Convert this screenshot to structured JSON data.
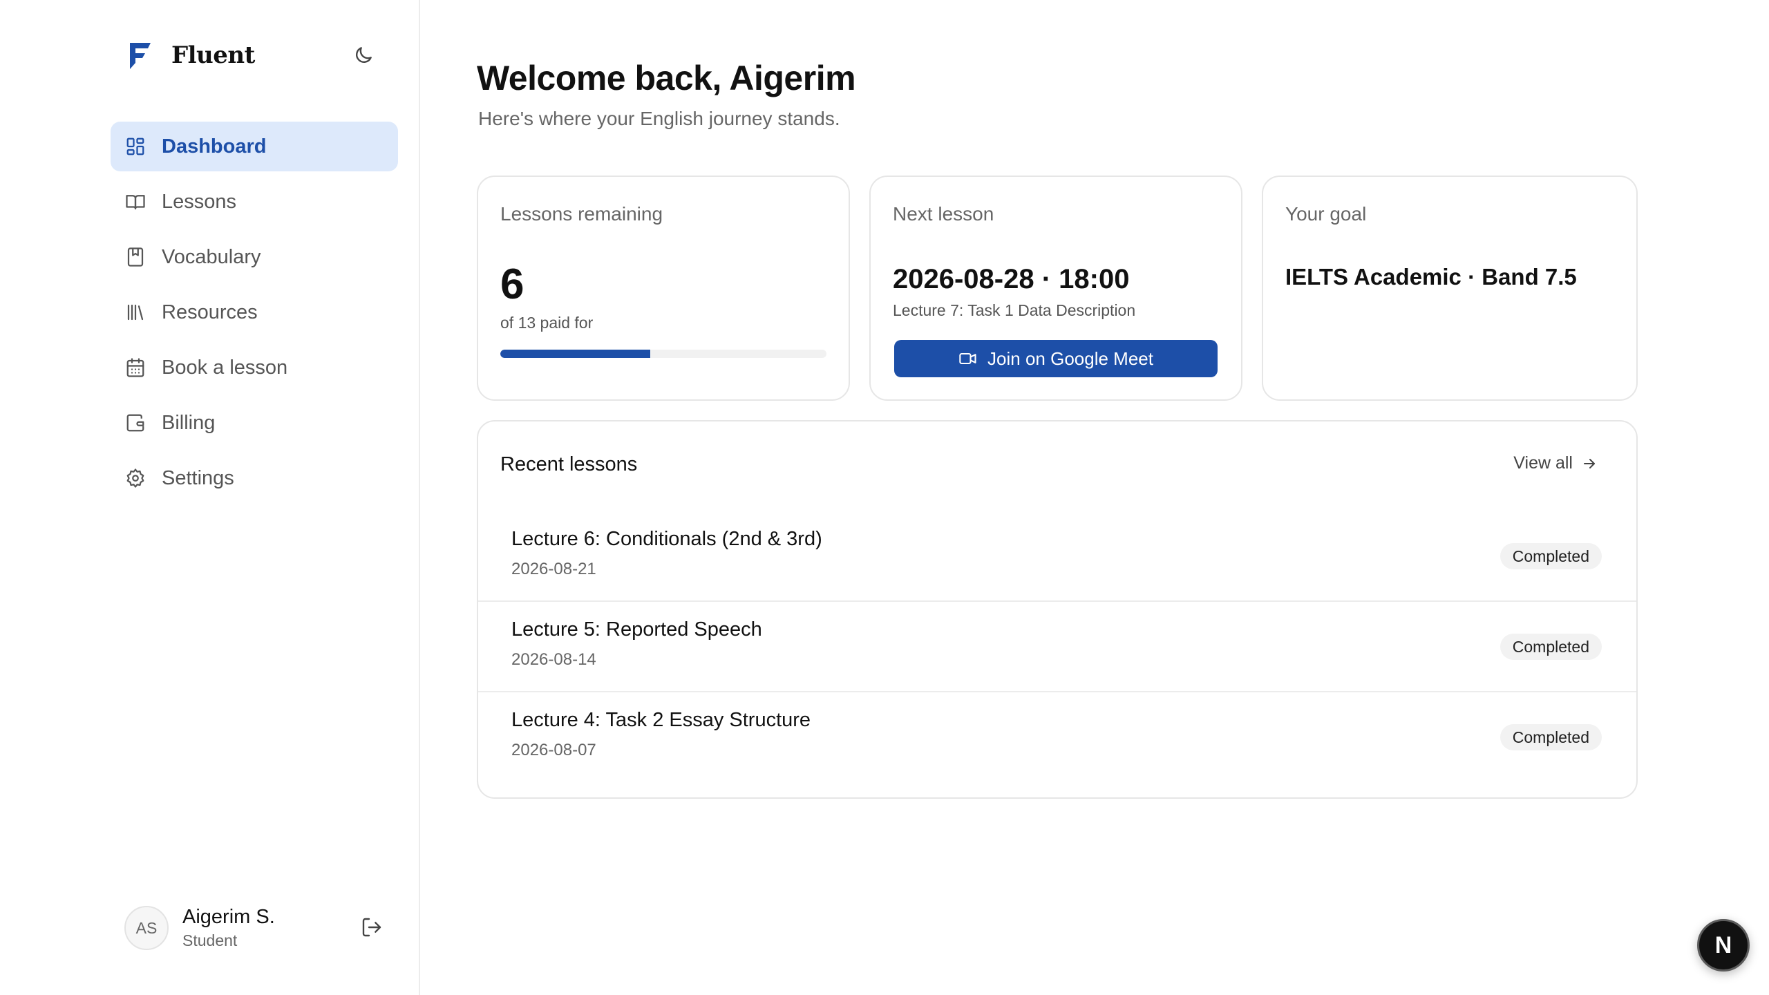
{
  "brand": {
    "name": "Fluent",
    "color": "#1d4fa8"
  },
  "icons": {
    "theme": "moon-icon",
    "logout": "logout-icon",
    "meet": "video-camera-icon",
    "view_all": "arrow-right-icon"
  },
  "sidebar": {
    "items": [
      {
        "label": "Dashboard",
        "icon": "dashboard-grid-icon",
        "active": true
      },
      {
        "label": "Lessons",
        "icon": "book-open-icon"
      },
      {
        "label": "Vocabulary",
        "icon": "bookmark-book-icon"
      },
      {
        "label": "Resources",
        "icon": "library-icon"
      },
      {
        "label": "Book a lesson",
        "icon": "calendar-icon"
      },
      {
        "label": "Billing",
        "icon": "wallet-icon"
      },
      {
        "label": "Settings",
        "icon": "gear-icon"
      }
    ]
  },
  "user": {
    "initials": "AS",
    "name": "Aigerim S.",
    "role": "Student"
  },
  "main": {
    "title": "Welcome back, Aigerim",
    "subtitle": "Here's where your English journey stands."
  },
  "cards": {
    "lessons_remaining": {
      "label": "Lessons remaining",
      "value": "6",
      "caption": "of 13 paid for",
      "progress": 0.46
    },
    "next_lesson": {
      "label": "Next lesson",
      "datetime": "2026-08-28 · 18:00",
      "title": "Lecture 7: Task 1 Data Description",
      "button_label": "Join on Google Meet"
    },
    "goal": {
      "label": "Your goal",
      "value": "IELTS Academic · Band 7.5"
    }
  },
  "recent": {
    "title": "Recent lessons",
    "view_all": "View all",
    "rows": [
      {
        "title": "Lecture 6: Conditionals (2nd & 3rd)",
        "date": "2026-08-21",
        "status": "Completed"
      },
      {
        "title": "Lecture 5: Reported Speech",
        "date": "2026-08-14",
        "status": "Completed"
      },
      {
        "title": "Lecture 4: Task 2 Essay Structure",
        "date": "2026-08-07",
        "status": "Completed"
      }
    ]
  },
  "fab": {
    "label": "N"
  }
}
